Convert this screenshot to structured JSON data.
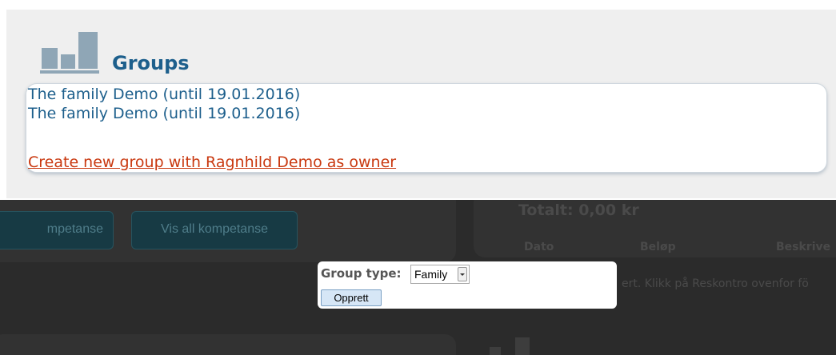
{
  "groups": {
    "title": "Groups",
    "items": [
      {
        "label": "The family Demo (until 19.01.2016)"
      },
      {
        "label": "The family Demo (until 19.01.2016)"
      }
    ],
    "create_link": "Create new group with Ragnhild Demo as owner"
  },
  "background_app": {
    "buttons": [
      "mpetanse",
      "Vis all kompetanse"
    ],
    "totalt": "Totalt: 0,00 kr",
    "table_headers": [
      "Dato",
      "Beløp",
      "Beskrive"
    ],
    "info_text": "ert. Klikk på Reskontro ovenfor fö"
  },
  "popup": {
    "group_type_label": "Group type:",
    "group_type_value": "Family",
    "submit_label": "Opprett"
  },
  "colors": {
    "title_blue": "#1d5f8c",
    "link_red": "#c9380f",
    "panel_bg": "#efefef",
    "dark_bg": "#2b2b2b",
    "button_teal": "#173a44"
  }
}
